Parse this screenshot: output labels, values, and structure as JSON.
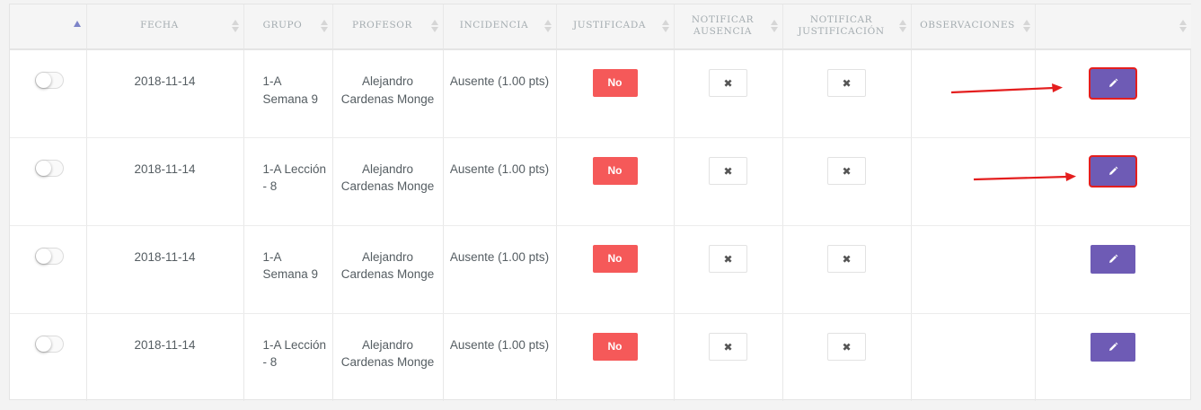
{
  "table": {
    "headers": [
      {
        "label": ""
      },
      {
        "label": "Fecha"
      },
      {
        "label": "Grupo"
      },
      {
        "label": "Profesor"
      },
      {
        "label": "Incidencia"
      },
      {
        "label": "Justificada"
      },
      {
        "label": "Notificar ausencia"
      },
      {
        "label": "Notificar justificación"
      },
      {
        "label": "Observaciones"
      },
      {
        "label": ""
      }
    ],
    "rows": [
      {
        "fecha": "2018-11-14",
        "grupo": "1-A Semana 9",
        "profesor": "Alejandro Cardenas Monge",
        "incidencia": "Ausente (1.00 pts)",
        "justificada": "No",
        "notificar_ausencia": "✖",
        "notificar_justificacion": "✖",
        "observaciones": "",
        "highlighted": true
      },
      {
        "fecha": "2018-11-14",
        "grupo": "1-A Lección - 8",
        "profesor": "Alejandro Cardenas Monge",
        "incidencia": "Ausente (1.00 pts)",
        "justificada": "No",
        "notificar_ausencia": "✖",
        "notificar_justificacion": "✖",
        "observaciones": "",
        "highlighted": true
      },
      {
        "fecha": "2018-11-14",
        "grupo": "1-A Semana 9",
        "profesor": "Alejandro Cardenas Monge",
        "incidencia": "Ausente (1.00 pts)",
        "justificada": "No",
        "notificar_ausencia": "✖",
        "notificar_justificacion": "✖",
        "observaciones": "",
        "highlighted": false
      },
      {
        "fecha": "2018-11-14",
        "grupo": "1-A Lección - 8",
        "profesor": "Alejandro Cardenas Monge",
        "incidencia": "Ausente (1.00 pts)",
        "justificada": "No",
        "notificar_ausencia": "✖",
        "notificar_justificacion": "✖",
        "observaciones": "",
        "highlighted": false
      }
    ],
    "icons": {
      "toggle": "toggle-switch-off",
      "edit": "pencil-icon",
      "sort": "sort-arrows-icon",
      "sort_active": "sort-ascending-icon"
    }
  },
  "colors": {
    "no_button": "#f55959",
    "edit_button": "#6e5bb5",
    "highlight": "#e41e1e",
    "arrow": "#e41e1e"
  }
}
